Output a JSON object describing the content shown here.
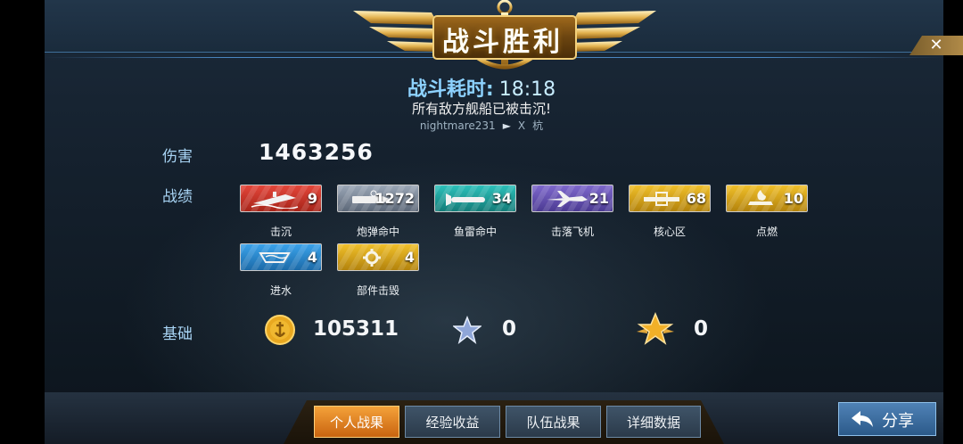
{
  "header": {
    "title": "战斗胜利",
    "close_symbol": "✕"
  },
  "battle": {
    "time_label": "战斗耗时:",
    "time_value": "18:18",
    "message": "所有敌方舰船已被击沉!",
    "killer_name": "nightmare231",
    "killer_arrow": "►",
    "killer_weapon": "X",
    "killer_target": "杭"
  },
  "damage": {
    "label": "伤害",
    "value": "1463256"
  },
  "record": {
    "label": "战绩",
    "medals": [
      {
        "name": "击沉",
        "count": "9",
        "color": "#d93a2b",
        "icon": "sinking-ship-icon"
      },
      {
        "name": "炮弹命中",
        "count": "1272",
        "color": "#8a97a8",
        "icon": "shell-icon"
      },
      {
        "name": "鱼雷命中",
        "count": "34",
        "color": "#1fa7a2",
        "icon": "torpedo-icon"
      },
      {
        "name": "击落飞机",
        "count": "21",
        "color": "#6a55b8",
        "icon": "plane-icon"
      },
      {
        "name": "核心区",
        "count": "68",
        "color": "#d9a416",
        "icon": "core-icon"
      },
      {
        "name": "点燃",
        "count": "10",
        "color": "#d9a416",
        "icon": "fire-icon"
      },
      {
        "name": "进水",
        "count": "4",
        "color": "#2f8fd6",
        "icon": "flooding-icon"
      },
      {
        "name": "部件击毁",
        "count": "4",
        "color": "#d9a416",
        "icon": "gear-icon"
      }
    ]
  },
  "basic": {
    "label": "基础",
    "coins": "105311",
    "silver_stars": "0",
    "gold_stars": "0"
  },
  "tabs": [
    "个人战果",
    "经验收益",
    "队伍战果",
    "详细数据"
  ],
  "share": {
    "label": "分享"
  }
}
